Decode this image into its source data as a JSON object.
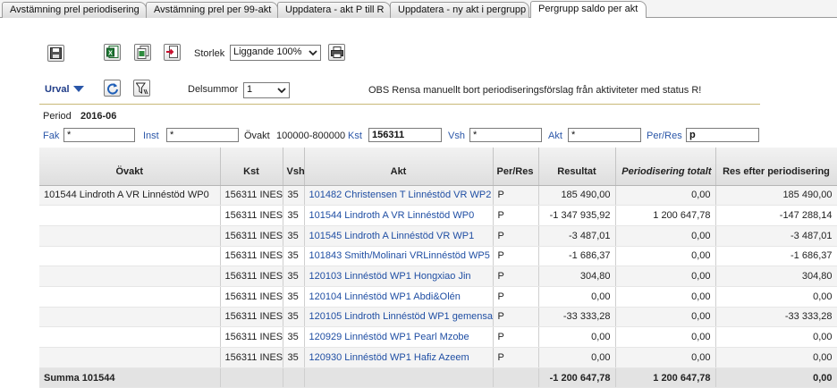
{
  "tabs": [
    {
      "label": "Avstämning prel periodisering",
      "active": false
    },
    {
      "label": "Avstämning prel per 99-akt",
      "active": false
    },
    {
      "label": "Uppdatera - akt P till R",
      "active": false
    },
    {
      "label": "Uppdatera - ny akt i pergrupp",
      "active": false
    },
    {
      "label": "Pergrupp saldo per akt",
      "active": true
    }
  ],
  "toolbar": {
    "storlek_label": "Storlek",
    "storlek_value": "Liggande 100%",
    "urval_label": "Urval",
    "delsummor_label": "Delsummor",
    "delsummor_value": "1",
    "notice": "OBS Rensa manuellt bort periodiseringsförslag från aktiviteter med status R!"
  },
  "filters": {
    "period_label": "Period",
    "period_value": "2016-06",
    "fak_label": "Fak",
    "fak_value": "*",
    "inst_label": "Inst",
    "inst_value": "*",
    "ovakt_label": "Övakt",
    "ovakt_value": "100000-800000",
    "kst_label": "Kst",
    "kst_value": "156311",
    "vsh_label": "Vsh",
    "vsh_value": "*",
    "akt_label": "Akt",
    "akt_value": "*",
    "perres_label": "Per/Res",
    "perres_value": "p"
  },
  "table": {
    "headers": [
      "Övakt",
      "Kst",
      "Vsh",
      "Akt",
      "Per/Res",
      "Resultat",
      "Periodisering totalt",
      "Res efter periodisering"
    ],
    "rows": [
      [
        "101544 Lindroth A VR Linnéstöd WP0",
        "156311 INES",
        "35",
        "101482 Christensen T Linnéstöd VR WP2",
        "P",
        "185 490,00",
        "0,00",
        "185 490,00"
      ],
      [
        "",
        "156311 INES",
        "35",
        "101544 Lindroth A VR Linnéstöd WP0",
        "P",
        "-1 347 935,92",
        "1 200 647,78",
        "-147 288,14"
      ],
      [
        "",
        "156311 INES",
        "35",
        "101545 Lindroth A Linnéstöd VR WP1",
        "P",
        "-3 487,01",
        "0,00",
        "-3 487,01"
      ],
      [
        "",
        "156311 INES",
        "35",
        "101843 Smith/Molinari VRLinnéstöd WP5",
        "P",
        "-1 686,37",
        "0,00",
        "-1 686,37"
      ],
      [
        "",
        "156311 INES",
        "35",
        "120103 Linnéstöd WP1 Hongxiao Jin",
        "P",
        "304,80",
        "0,00",
        "304,80"
      ],
      [
        "",
        "156311 INES",
        "35",
        "120104 Linnéstöd WP1 Abdi&Olén",
        "P",
        "0,00",
        "0,00",
        "0,00"
      ],
      [
        "",
        "156311 INES",
        "35",
        "120105 Lindroth Linnéstöd WP1 gemensa",
        "P",
        "-33 333,28",
        "0,00",
        "-33 333,28"
      ],
      [
        "",
        "156311 INES",
        "35",
        "120929 Linnéstöd WP1 Pearl Mzobe",
        "P",
        "0,00",
        "0,00",
        "0,00"
      ],
      [
        "",
        "156311 INES",
        "35",
        "120930 Linnéstöd WP1 Hafiz Azeem",
        "P",
        "0,00",
        "0,00",
        "0,00"
      ]
    ],
    "summary": {
      "label": "Summa 101544",
      "resultat": "-1 200 647,78",
      "periodisering": "1 200 647,78",
      "res_efter": "0,00"
    }
  }
}
